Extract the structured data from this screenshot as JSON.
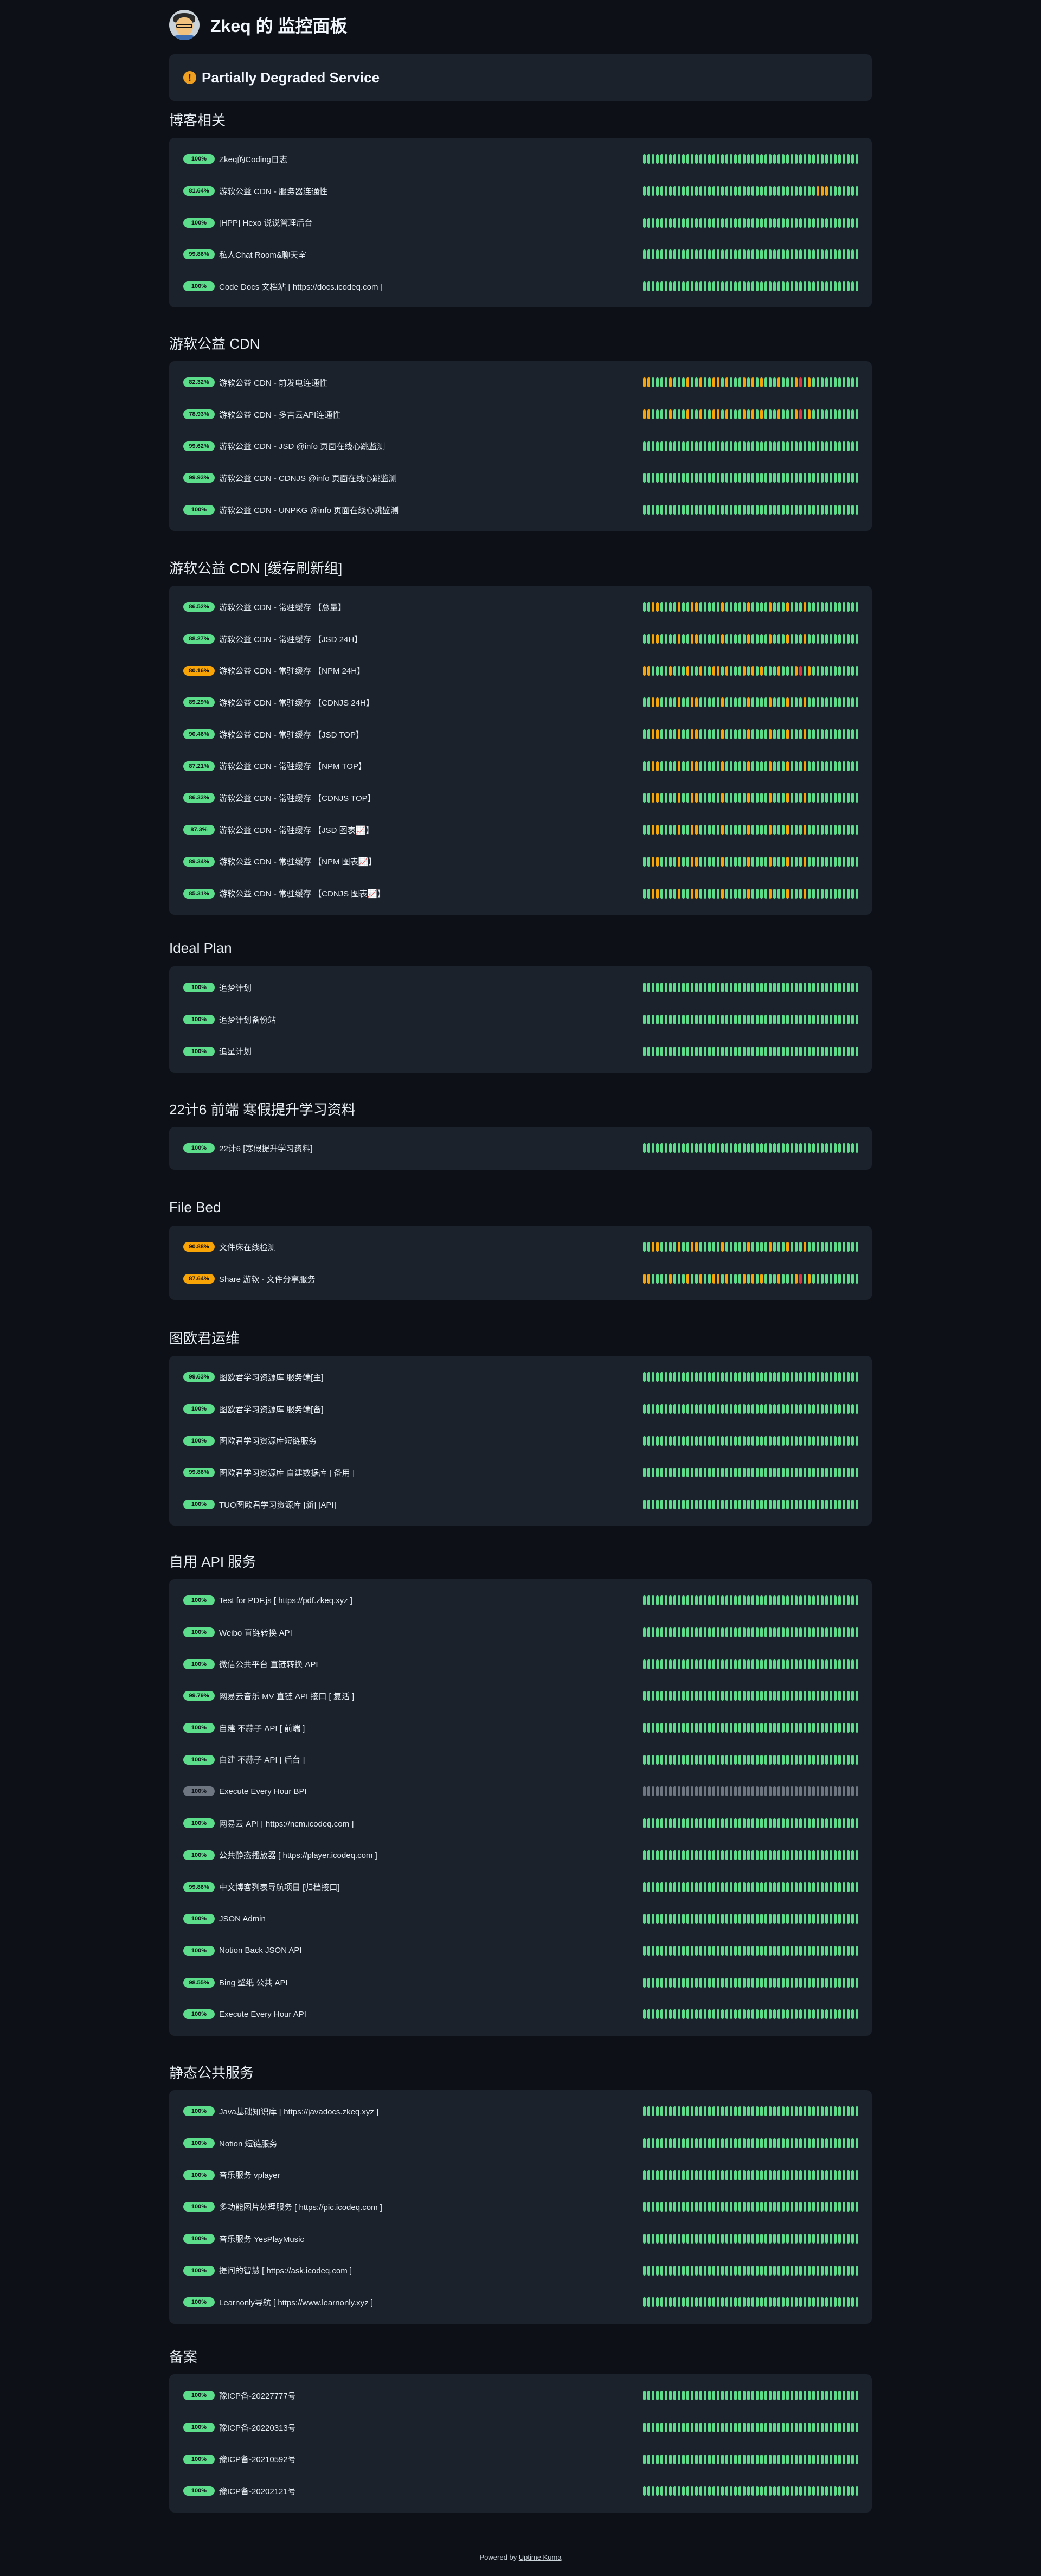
{
  "header": {
    "title": "Zkeq 的 监控面板",
    "logo_icon": "avatar-cartoon-icon"
  },
  "status": {
    "text": "Partially Degraded Service",
    "icon": "warning-icon"
  },
  "groups": [
    {
      "title": "博客相关",
      "monitors": [
        {
          "uptime": "100%",
          "state": "green",
          "name": "Zkeq的Coding日志",
          "beats": "all-green"
        },
        {
          "uptime": "81.64%",
          "state": "green",
          "name": "游软公益 CDN - 服务器连通性",
          "beats": "late-orange"
        },
        {
          "uptime": "100%",
          "state": "green",
          "name": "[HPP] Hexo 说说管理后台",
          "beats": "all-green"
        },
        {
          "uptime": "99.86%",
          "state": "green",
          "name": "私人Chat Room&聊天室",
          "beats": "all-green"
        },
        {
          "uptime": "100%",
          "state": "green",
          "name": "Code Docs 文档站 [ https://docs.icodeq.com ]",
          "beats": "all-green"
        }
      ]
    },
    {
      "title": "游软公益 CDN",
      "monitors": [
        {
          "uptime": "82.32%",
          "state": "green",
          "name": "游软公益 CDN - 前发电连通性",
          "beats": "mixed-heavy"
        },
        {
          "uptime": "78.93%",
          "state": "green",
          "name": "游软公益 CDN - 多吉云API连通性",
          "beats": "mixed-heavy"
        },
        {
          "uptime": "99.62%",
          "state": "green",
          "name": "游软公益 CDN - JSD @info 页面在线心跳监测",
          "beats": "all-green"
        },
        {
          "uptime": "99.93%",
          "state": "green",
          "name": "游软公益 CDN - CDNJS @info 页面在线心跳监测",
          "beats": "all-green"
        },
        {
          "uptime": "100%",
          "state": "green",
          "name": "游软公益 CDN - UNPKG @info 页面在线心跳监测",
          "beats": "all-green"
        }
      ]
    },
    {
      "title": "游软公益 CDN [缓存刷新组]",
      "monitors": [
        {
          "uptime": "86.52%",
          "state": "green",
          "name": "游软公益 CDN - 常驻缓存 【总量】",
          "beats": "mixed-light"
        },
        {
          "uptime": "88.27%",
          "state": "green",
          "name": "游软公益 CDN - 常驻缓存 【JSD 24H】",
          "beats": "mixed-light"
        },
        {
          "uptime": "80.16%",
          "state": "orange",
          "name": "游软公益 CDN - 常驻缓存 【NPM 24H】",
          "beats": "mixed-heavy"
        },
        {
          "uptime": "89.29%",
          "state": "green",
          "name": "游软公益 CDN - 常驻缓存 【CDNJS 24H】",
          "beats": "mixed-light"
        },
        {
          "uptime": "90.46%",
          "state": "green",
          "name": "游软公益 CDN - 常驻缓存 【JSD TOP】",
          "beats": "mixed-light"
        },
        {
          "uptime": "87.21%",
          "state": "green",
          "name": "游软公益 CDN - 常驻缓存 【NPM TOP】",
          "beats": "mixed-light"
        },
        {
          "uptime": "86.33%",
          "state": "green",
          "name": "游软公益 CDN - 常驻缓存 【CDNJS TOP】",
          "beats": "mixed-light"
        },
        {
          "uptime": "87.3%",
          "state": "green",
          "name": "游软公益 CDN - 常驻缓存 【JSD 图表📈】",
          "beats": "mixed-light"
        },
        {
          "uptime": "89.34%",
          "state": "green",
          "name": "游软公益 CDN - 常驻缓存 【NPM 图表📈】",
          "beats": "mixed-light"
        },
        {
          "uptime": "85.31%",
          "state": "green",
          "name": "游软公益 CDN - 常驻缓存 【CDNJS 图表📈】",
          "beats": "mixed-light"
        }
      ]
    },
    {
      "title": "Ideal Plan",
      "monitors": [
        {
          "uptime": "100%",
          "state": "green",
          "name": "追梦计划",
          "beats": "all-green"
        },
        {
          "uptime": "100%",
          "state": "green",
          "name": "追梦计划备份站",
          "beats": "all-green"
        },
        {
          "uptime": "100%",
          "state": "green",
          "name": "追星计划",
          "beats": "all-green"
        }
      ]
    },
    {
      "title": "22计6 前端 寒假提升学习资料",
      "monitors": [
        {
          "uptime": "100%",
          "state": "green",
          "name": "22计6 [寒假提升学习资料]",
          "beats": "all-green"
        }
      ]
    },
    {
      "title": "File Bed",
      "monitors": [
        {
          "uptime": "90.88%",
          "state": "orange",
          "name": "文件床在线检测",
          "beats": "mixed-light"
        },
        {
          "uptime": "87.64%",
          "state": "orange",
          "name": "Share 游软 - 文件分享服务",
          "beats": "mixed-heavy"
        }
      ]
    },
    {
      "title": "图欧君运维",
      "monitors": [
        {
          "uptime": "99.63%",
          "state": "green",
          "name": "图欧君学习资源库 服务端[主]",
          "beats": "all-green"
        },
        {
          "uptime": "100%",
          "state": "green",
          "name": "图欧君学习资源库 服务端[备]",
          "beats": "all-green"
        },
        {
          "uptime": "100%",
          "state": "green",
          "name": "图欧君学习资源库短链服务",
          "beats": "all-green"
        },
        {
          "uptime": "99.86%",
          "state": "green",
          "name": "图欧君学习资源库 自建数据库 [ 备用 ]",
          "beats": "all-green"
        },
        {
          "uptime": "100%",
          "state": "green",
          "name": "TUO图欧君学习资源库 [新] [API]",
          "beats": "all-green"
        }
      ]
    },
    {
      "title": "自用 API 服务",
      "monitors": [
        {
          "uptime": "100%",
          "state": "green",
          "name": "Test for PDF.js [ https://pdf.zkeq.xyz ]",
          "beats": "all-green"
        },
        {
          "uptime": "100%",
          "state": "green",
          "name": "Weibo 直链转换 API",
          "beats": "all-green"
        },
        {
          "uptime": "100%",
          "state": "green",
          "name": "微信公共平台 直链转换 API",
          "beats": "all-green"
        },
        {
          "uptime": "99.79%",
          "state": "green",
          "name": "网易云音乐 MV 直链 API 接口 [ 复活 ]",
          "beats": "all-green"
        },
        {
          "uptime": "100%",
          "state": "green",
          "name": "自建 不蒜子 API [ 前端 ]",
          "beats": "all-green"
        },
        {
          "uptime": "100%",
          "state": "green",
          "name": "自建 不蒜子 API [ 后台 ]",
          "beats": "all-green"
        },
        {
          "uptime": "100%",
          "state": "gray",
          "name": "Execute Every Hour BPI",
          "beats": "all-gray"
        },
        {
          "uptime": "100%",
          "state": "green",
          "name": "网易云 API [ https://ncm.icodeq.com ]",
          "beats": "all-green"
        },
        {
          "uptime": "100%",
          "state": "green",
          "name": "公共静态播放器 [ https://player.icodeq.com ]",
          "beats": "all-green"
        },
        {
          "uptime": "99.86%",
          "state": "green",
          "name": "中文博客列表导航项目 [归档接口]",
          "beats": "all-green"
        },
        {
          "uptime": "100%",
          "state": "green",
          "name": "JSON Admin",
          "beats": "all-green"
        },
        {
          "uptime": "100%",
          "state": "green",
          "name": "Notion Back JSON API",
          "beats": "all-green"
        },
        {
          "uptime": "98.55%",
          "state": "green",
          "name": "Bing 壁纸 公共 API",
          "beats": "all-green"
        },
        {
          "uptime": "100%",
          "state": "green",
          "name": "Execute Every Hour API",
          "beats": "all-green"
        }
      ]
    },
    {
      "title": "静态公共服务",
      "monitors": [
        {
          "uptime": "100%",
          "state": "green",
          "name": "Java基础知识库 [ https://javadocs.zkeq.xyz ]",
          "beats": "all-green"
        },
        {
          "uptime": "100%",
          "state": "green",
          "name": "Notion 短链服务",
          "beats": "all-green"
        },
        {
          "uptime": "100%",
          "state": "green",
          "name": "音乐服务 vplayer",
          "beats": "all-green"
        },
        {
          "uptime": "100%",
          "state": "green",
          "name": "多功能图片处理服务 [ https://pic.icodeq.com ]",
          "beats": "all-green"
        },
        {
          "uptime": "100%",
          "state": "green",
          "name": "音乐服务 YesPlayMusic",
          "beats": "all-green"
        },
        {
          "uptime": "100%",
          "state": "green",
          "name": "提问的智慧 [ https://ask.icodeq.com ]",
          "beats": "all-green"
        },
        {
          "uptime": "100%",
          "state": "green",
          "name": "Learnonly导航 [ https://www.learnonly.xyz ]",
          "beats": "all-green"
        }
      ]
    },
    {
      "title": "备案",
      "monitors": [
        {
          "uptime": "100%",
          "state": "green",
          "name": "豫ICP备-20227777号",
          "beats": "all-green"
        },
        {
          "uptime": "100%",
          "state": "green",
          "name": "豫ICP备-20220313号",
          "beats": "all-green"
        },
        {
          "uptime": "100%",
          "state": "green",
          "name": "豫ICP备-20210592号",
          "beats": "all-green"
        },
        {
          "uptime": "100%",
          "state": "green",
          "name": "豫ICP备-20202121号",
          "beats": "all-green"
        }
      ]
    }
  ],
  "footer": {
    "prefix": "Powered by",
    "link": "Uptime Kuma"
  },
  "colors": {
    "up": "#5cdd8b",
    "degraded": "#f8a306",
    "down": "#dc3545",
    "paused": "#6e7681"
  }
}
